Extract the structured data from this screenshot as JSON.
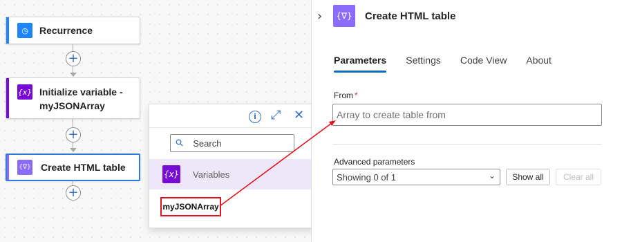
{
  "workflow": {
    "steps": [
      {
        "title": "Recurrence",
        "icon": "clock-icon"
      },
      {
        "title": "Initialize variable - myJSONArray",
        "icon": "variable-icon"
      },
      {
        "title": "Create HTML table",
        "icon": "data-operation-icon"
      }
    ],
    "add_step_symbol": "+"
  },
  "dynamic_content": {
    "search_placeholder": "Search",
    "category_label": "Variables",
    "token_label": "myJSONArray"
  },
  "panel": {
    "title": "Create HTML table",
    "tabs": [
      {
        "label": "Parameters",
        "active": true
      },
      {
        "label": "Settings",
        "active": false
      },
      {
        "label": "Code View",
        "active": false
      },
      {
        "label": "About",
        "active": false
      }
    ],
    "from_label": "From",
    "required_marker": "*",
    "from_placeholder": "Array to create table from",
    "advanced_label": "Advanced parameters",
    "advanced_select": "Showing 0 of 1",
    "show_all": "Show all",
    "clear_all": "Clear all"
  },
  "colors": {
    "trigger_blue": "#1f85ff",
    "variable_purple": "#770bd6",
    "data_op_purple": "#8c6cff",
    "selected_border": "#2f7bd7",
    "annotation_red": "#e0141e",
    "tab_underline": "#0f6cbd"
  }
}
